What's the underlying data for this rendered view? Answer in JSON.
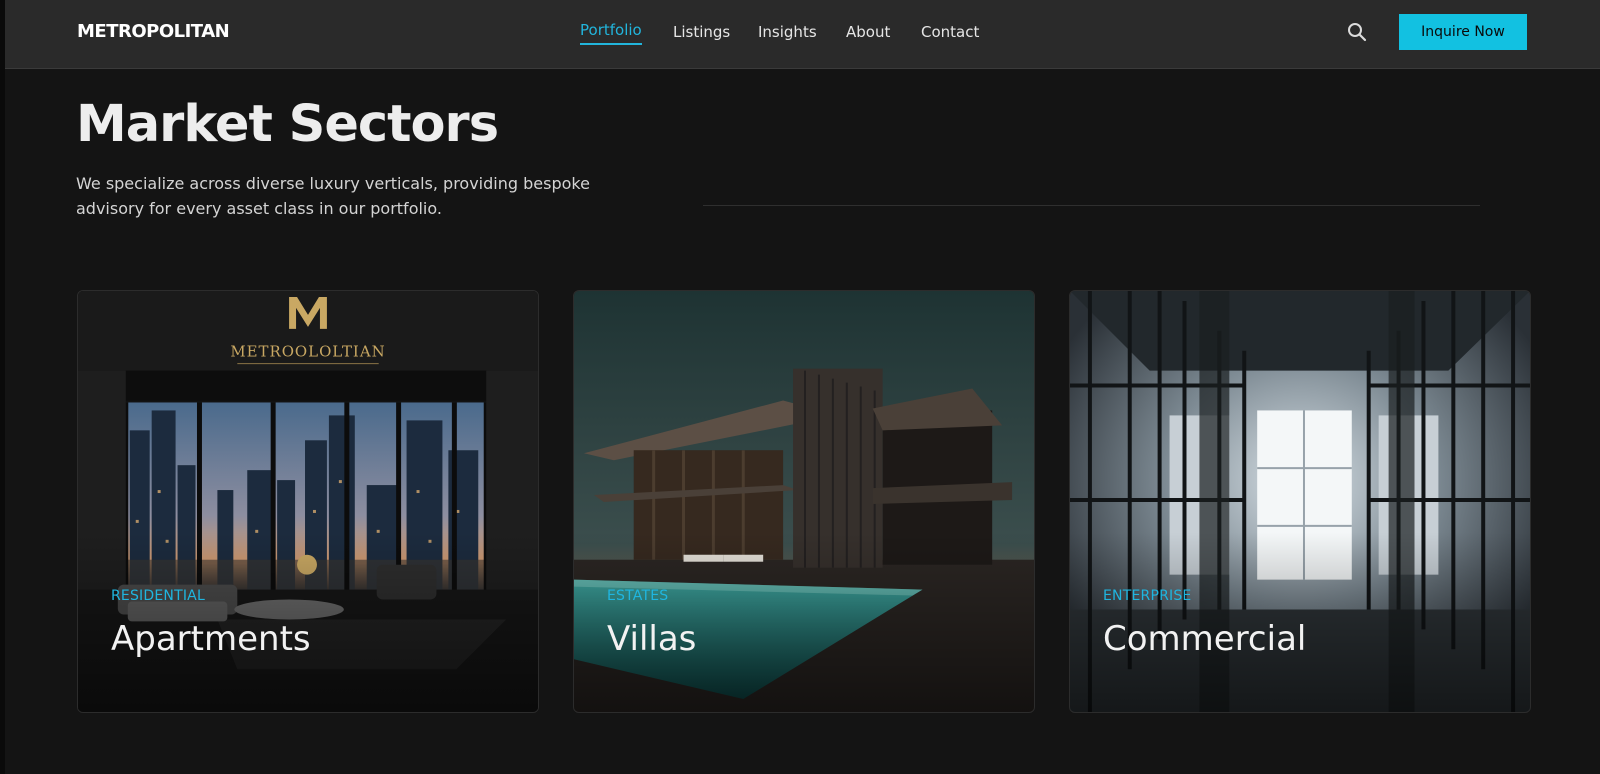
{
  "app": {
    "brand": "METROPOLITAN"
  },
  "nav": {
    "links": [
      {
        "label": "Portfolio",
        "active": true
      },
      {
        "label": "Listings",
        "active": false
      },
      {
        "label": "Insights",
        "active": false
      },
      {
        "label": "About",
        "active": false
      },
      {
        "label": "Contact",
        "active": false
      }
    ],
    "search_icon": "search-icon",
    "cta_label": "Inquire Now"
  },
  "hero": {
    "title": "Market Sectors",
    "subtitle_line1": "We specialize across diverse luxury verticals, providing bespoke",
    "subtitle_line2": "advisory for every asset class in our portfolio."
  },
  "cards": [
    {
      "eyebrow": "RESIDENTIAL",
      "title": "Apartments",
      "image_logo": "METROOLOLTIAN"
    },
    {
      "eyebrow": "ESTATES",
      "title": "Villas"
    },
    {
      "eyebrow": "ENTERPRISE",
      "title": "Commercial"
    }
  ],
  "colors": {
    "accent": "#12c1e1",
    "background": "#141414",
    "header": "#2a2a2a"
  }
}
